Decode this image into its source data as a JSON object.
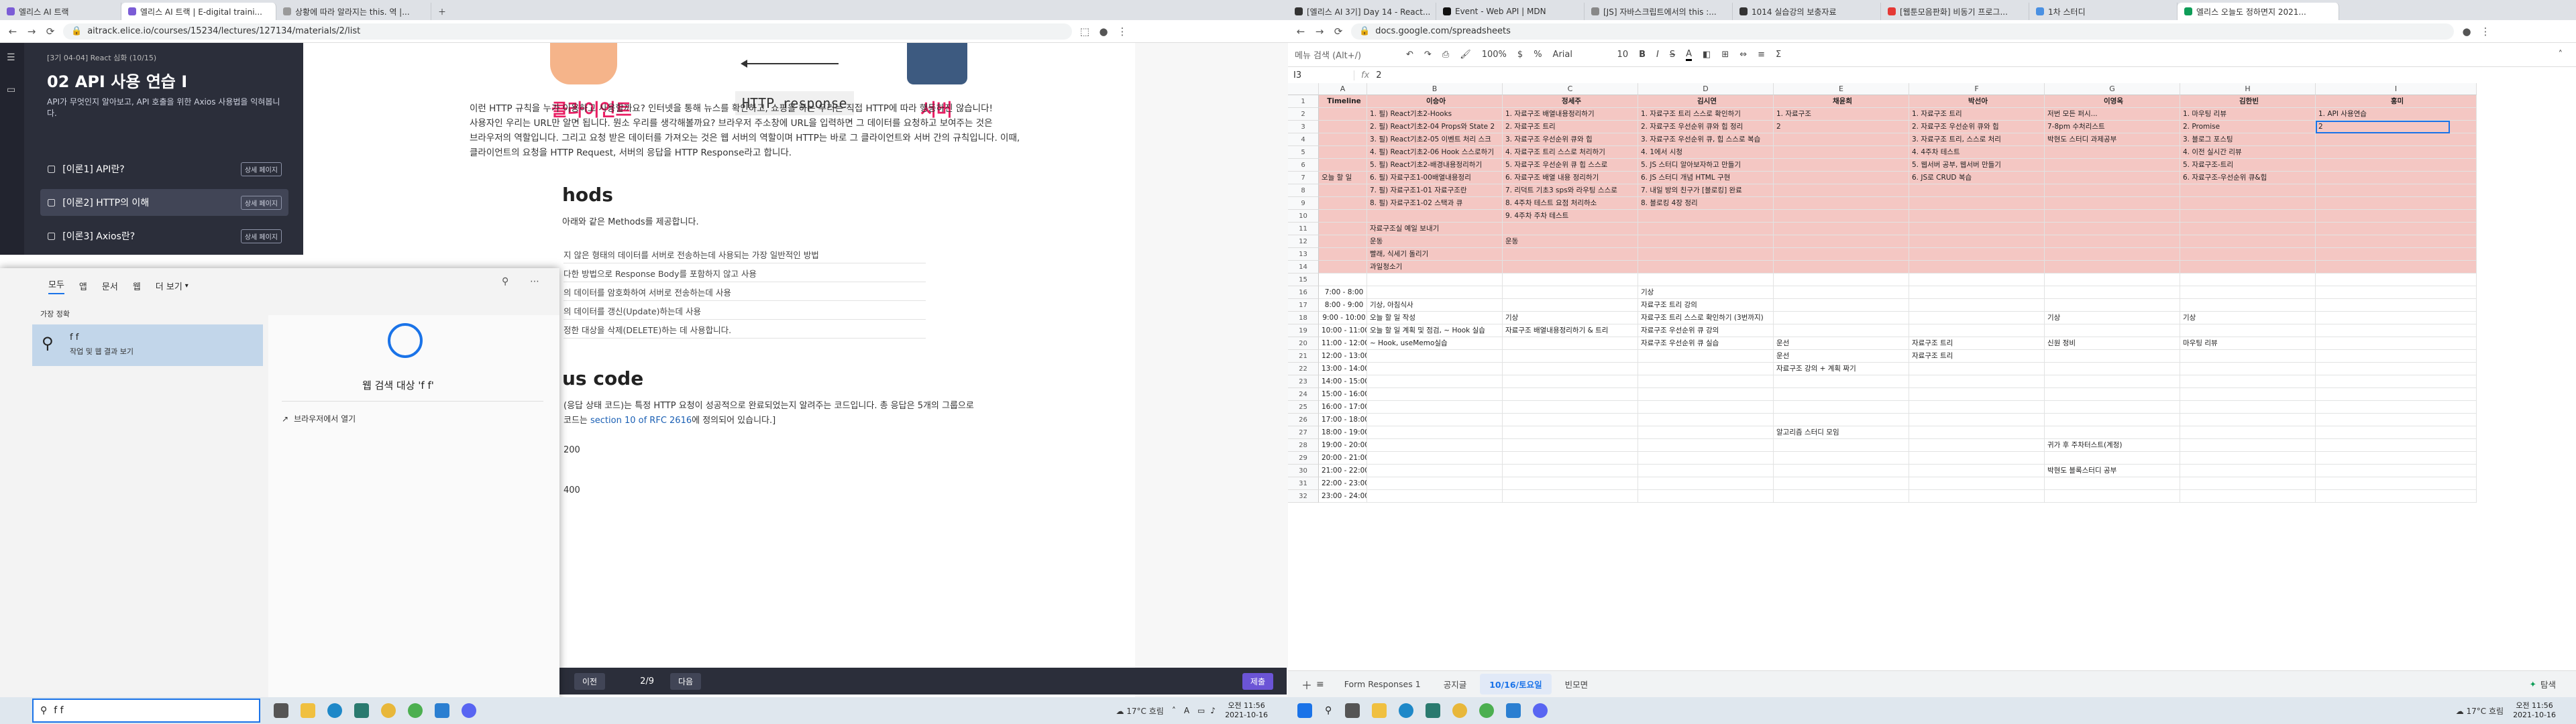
{
  "left_browser": {
    "tabs": [
      {
        "label": "엘리스 AI 트랙",
        "active": false
      },
      {
        "label": "엘리스 AI 트랙 | E-digital traini...",
        "active": true
      },
      {
        "label": "상황에 따라 알라지는 this. 역 |...",
        "active": false
      }
    ],
    "url": "aitrack.elice.io/courses/15234/lectures/127134/materials/2/list"
  },
  "course": {
    "header": "[3기 04-04] React 심화 (10/15)",
    "title": "02 API 사용 연습 I",
    "description": "API가 무엇인지 알아보고, API 호출을 위한 Axios 사용법을 익혀봅니다.",
    "items": [
      {
        "label": "[이론1] API란?",
        "badge": "상세 페이지",
        "active": false
      },
      {
        "label": "[이론2] HTTP의 이해",
        "badge": "상세 페이지",
        "active": true
      },
      {
        "label": "[이론3] Axios란?",
        "badge": "상세 페이지",
        "active": false
      }
    ]
  },
  "lecture": {
    "diagram_client": "클라이언트",
    "diagram_response": "HTTP response",
    "diagram_server": "서버",
    "para1_line1": "이런 HTTP 규칙을 누가 이용하고 사용할까요? 인터넷을 통해 뉴스를 확인하고, 쇼핑을 하는 우리는 직접 HTTP에 따라 행동하진 않습니다!",
    "para1_line2": "사용자인 우리는 URL만 알면 됩니다. 뭔소 우리를 생각해볼까요? 브라우저 주소창에 URL을 입력하면 그 데이터를 요청하고 보여주는 것은",
    "para1_line3": "브라우저의 역할입니다. 그리고 요청 받은 데이터를 가져오는 것은 웹 서버의 역할이며 HTTP는 바로 그 클라이언트와 서버 간의 규칙입니다. 이때,",
    "para1_line4": "클라이언트의 요청을 HTTP Request, 서버의 응답을 HTTP Response라고 합니다.",
    "methods_heading": "hods",
    "methods_desc": "아래와 같은 Methods를 제공합니다.",
    "method_rows": [
      "지 않은 형태의 데이터를 서버로 전송하는데 사용되는 가장 일반적인 방법",
      "다한 방법으로 Response Body를 포함하지 않고 사용",
      "의 데이터를 암호화하여 서버로 전송하는데 사용",
      "의 데이터를 갱신(Update)하는데 사용",
      "정한 대상을 삭제(DELETE)하는 데 사용합니다."
    ],
    "status_heading": "us code",
    "status_line1": "(응답 상태 코드)는 특정 HTTP 요청이 성공적으로 완료되었는지 알려주는 코드입니다. 총 응답은 5개의 그룹으로",
    "status_line2_pre": "코드는 ",
    "status_link": "section 10 of RFC 2616",
    "status_line2_post": "에 정의되어 있습니다.]",
    "code_200": "200",
    "code_400": "400",
    "nav_prev": "이전",
    "nav_page": "2/9",
    "nav_next": "다음",
    "nav_submit": "제출"
  },
  "search_panel": {
    "tabs": [
      "모두",
      "앱",
      "문서",
      "웹",
      "더 보기"
    ],
    "best_match": "가장 정확",
    "result_title": "f f",
    "result_sub": "작업 및 웹 결과 보기",
    "web_search_label": "웹 검색 대상 'f f'",
    "open_in_browser": "브라우저에서 열기",
    "query": "f f"
  },
  "left_taskbar": {
    "temp": "17°C 흐림",
    "ime": "A",
    "time": "오전 11:56",
    "date": "2021-10-16"
  },
  "right_browser": {
    "tabs": [
      {
        "label": "[엘리스 AI 3기] Day 14 - React...",
        "active": false
      },
      {
        "label": "Event - Web API | MDN",
        "active": false
      },
      {
        "label": "[JS] 자바스크립트에서의 this :...",
        "active": false
      },
      {
        "label": "1014 실습강의 보충자료",
        "active": false
      },
      {
        "label": "[웹툰모음판화] 비동기 프로그...",
        "active": false
      },
      {
        "label": "1차 스터디",
        "active": false
      },
      {
        "label": "엘리스 오늘도 정하면지 2021...",
        "active": true
      }
    ],
    "url": "docs.google.com/spreadsheets",
    "menu_search": "메뉴 검색 (Alt+/)",
    "zoom": "100%",
    "font": "Arial",
    "font_size": "10",
    "cell_ref": "I3",
    "formula_value": "2"
  },
  "sheet": {
    "columns": [
      "A",
      "B",
      "C",
      "D",
      "E",
      "F",
      "G",
      "H",
      "I"
    ],
    "header_row": [
      "Timeline",
      "이승아",
      "정세주",
      "김시연",
      "채윤희",
      "박선아",
      "이영옥",
      "김한빈",
      "홍미"
    ],
    "section_label": "오늘 할 일",
    "todo_rows": [
      [
        "1. 필) React기초2-Hooks",
        "1. 자료구조 배열내용정리하기",
        "1. 자료구조 트리 스스로 확인하기",
        "1. 자료구조",
        "1. 자료구조 트리",
        "저번 모든 퍼시...",
        "1. 마우팅 리뷰",
        "1. API 사용연습"
      ],
      [
        "2. 필) React기초2-04 Props와 State 2",
        "2. 자료구조 트리",
        "2. 자료구조 우선순위 큐와 힙 정리",
        "2",
        "2. 자료구조 우선순위 큐와 힙",
        "7-8pm 수처리스트",
        "2. Promise",
        "2"
      ],
      [
        "3. 필) React기초2-05 이벤트 처리 스크",
        "3. 자료구조 우선순위 큐와 힙",
        "3. 자료구조 우선순위 큐, 힙 스스로 복습",
        "",
        "3. 자료구조 트리, 스스로 처리",
        "박현도 스터디 과제공부",
        "3. 블로그 포스팅",
        ""
      ],
      [
        "4. 필) React기초2-06 Hook 스스로하기",
        "4. 자료구조 트리 스스로 처리하기",
        "4. 1에서 시청",
        "",
        "4. 4주차 테스트",
        "",
        "4. 이전 실시간 리뷰",
        ""
      ],
      [
        "5. 필) React기초2-배경내용정리하기",
        "5. 자료구조 우선순위 큐 힙 스스로",
        "5. JS 스터디 알아보자하고 만들기",
        "",
        "5. 웹서버 공부, 웹서버 만들기",
        "",
        "5. 자료구조-트리",
        ""
      ],
      [
        "6. 필) 자료구조1-00배열내용정리",
        "6. 자료구조 배열 내용 정리하기",
        "6. JS 스터디 개념 HTML 구현",
        "",
        "6. JS로 CRUD 복습",
        "",
        "6. 자료구조-우선순위 큐&힙",
        ""
      ],
      [
        "7. 필) 자료구조1-01 자료구조란",
        "7. 리덕트 기초3 sps와 라우팅 스스로",
        "7. 내일 방의 친구가 [블로킹] 완료",
        "",
        "",
        "",
        "",
        ""
      ],
      [
        "8. 필) 자료구조1-02 스택과 큐",
        "8. 4주차 테스트 요점 처리하소",
        "8. 블로킹 4장 정리",
        "",
        "",
        "",
        "",
        ""
      ],
      [
        "",
        "9. 4주차 주차 테스트",
        "",
        "",
        "",
        "",
        "",
        ""
      ],
      [
        "자료구조실 예일 보내기",
        "",
        "",
        "",
        "",
        "",
        "",
        ""
      ],
      [
        "운동",
        "운동",
        "",
        "",
        "",
        "",
        "",
        ""
      ],
      [
        "빨래, 식세기 돌리기",
        "",
        "",
        "",
        "",
        "",
        "",
        ""
      ],
      [
        "과일청소기",
        "",
        "",
        "",
        "",
        "",
        "",
        ""
      ]
    ],
    "time_slots": [
      "7:00 - 8:00",
      "8:00 - 9:00",
      "9:00 - 10:00",
      "10:00 - 11:00",
      "11:00 - 12:00",
      "12:00 - 13:00",
      "13:00 - 14:00",
      "14:00 - 15:00",
      "15:00 - 16:00",
      "16:00 - 17:00",
      "17:00 - 18:00",
      "18:00 - 19:00",
      "19:00 - 20:00",
      "20:00 - 21:00",
      "21:00 - 22:00",
      "22:00 - 23:00",
      "23:00 - 24:00"
    ],
    "time_rows": [
      [
        "",
        "",
        "기상",
        "",
        "",
        "",
        "",
        ""
      ],
      [
        "기상, 아침식사",
        "",
        "자료구조 트리 강의",
        "",
        "",
        "",
        "",
        ""
      ],
      [
        "오늘 할 일 작성",
        "기상",
        "자료구조 트리 스스로 확인하기 (3번까지)",
        "",
        "",
        "기상",
        "기상",
        ""
      ],
      [
        "오늘 할 일 계획 및 점검, ~ Hook 실습",
        "자료구조 배열내용정리하기 & 트리",
        "자료구조 우선순위 큐 강의",
        "",
        "",
        "",
        "",
        ""
      ],
      [
        "~ Hook, useMemo실습",
        "",
        "자료구조 우선순위 큐 실습",
        "운선",
        "자료구조 트리",
        "신원 정비",
        "마우팅 리뷰",
        ""
      ],
      [
        "",
        "",
        "",
        "운선",
        "자료구조 트리",
        "",
        "",
        ""
      ],
      [
        "",
        "",
        "",
        "자료구조 강의 + 계획 짜기",
        "",
        "",
        "",
        ""
      ],
      [
        "",
        "",
        "",
        "",
        "",
        "",
        "",
        ""
      ],
      [
        "",
        "",
        "",
        "",
        "",
        "",
        "",
        ""
      ],
      [
        "",
        "",
        "",
        "",
        "",
        "",
        "",
        ""
      ],
      [
        "",
        "",
        "",
        "",
        "",
        "",
        "",
        ""
      ],
      [
        "",
        "",
        "",
        "알고리즘 스터디 모임",
        "",
        "",
        "",
        ""
      ],
      [
        "",
        "",
        "",
        "",
        "",
        "귀가 후 주차터스트(계정)",
        "",
        ""
      ],
      [
        "",
        "",
        "",
        "",
        "",
        "",
        "",
        ""
      ],
      [
        "",
        "",
        "",
        "",
        "",
        "박현도 블록스터디 공부",
        "",
        ""
      ],
      [
        "",
        "",
        "",
        "",
        "",
        "",
        "",
        ""
      ],
      [
        "",
        "",
        "",
        "",
        "",
        "",
        "",
        ""
      ]
    ],
    "sheet_tabs": [
      "Form Responses 1",
      "공지글",
      "10/16/토요일",
      "빈모면"
    ],
    "active_sheet": "10/16/토요일",
    "explore_label": "탐색"
  },
  "right_taskbar": {
    "temp": "17°C 흐림",
    "time": "오전 11:56",
    "date": "2021-10-16"
  },
  "colors": {
    "todo_bg": "#f4c7c3",
    "timeline_bg": "#f4c7c3",
    "accent_purple": "#7b5cd6",
    "course_dark": "#2b2e3a",
    "diagram_pink": "#e91e63"
  }
}
